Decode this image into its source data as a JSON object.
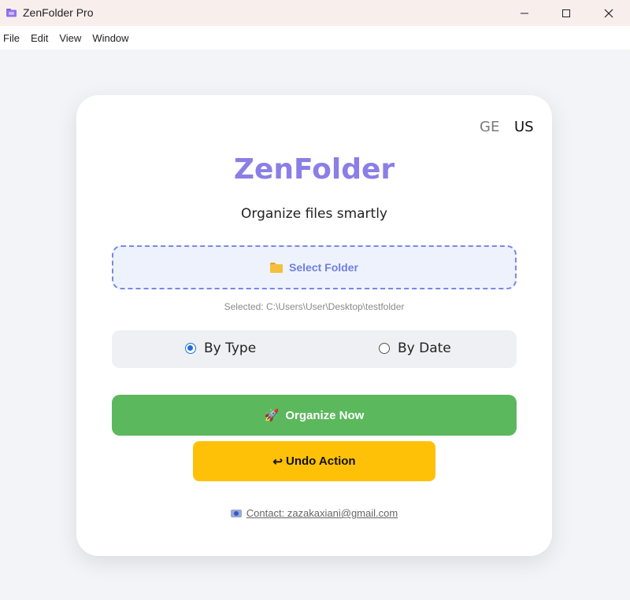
{
  "window": {
    "title": "ZenFolder Pro",
    "icons": {
      "app": "app-folder-icon",
      "minimize": "minimize-icon",
      "maximize": "maximize-icon",
      "close": "close-icon"
    }
  },
  "menu": {
    "items": [
      "File",
      "Edit",
      "View",
      "Window"
    ]
  },
  "languages": {
    "ge": "GE",
    "us": "US",
    "active": "US"
  },
  "main": {
    "brand": "ZenFolder",
    "subtitle": "Organize files smartly",
    "select_folder_label": "Select Folder",
    "selected_path": "Selected: C:\\Users\\User\\Desktop\\testfolder",
    "sort_options": [
      {
        "label": "By Type",
        "checked": true
      },
      {
        "label": "By Date",
        "checked": false
      }
    ],
    "organize_label": "Organize Now",
    "undo_label": "Undo Action",
    "contact_label": "Contact: zazakaxiani@gmail.com"
  },
  "colors": {
    "brand": "#8a7fe6",
    "select_border": "#7c86e6",
    "organize_bg": "#5cb85c",
    "undo_bg": "#ffc107",
    "radio_checked": "#1f6fd6"
  }
}
